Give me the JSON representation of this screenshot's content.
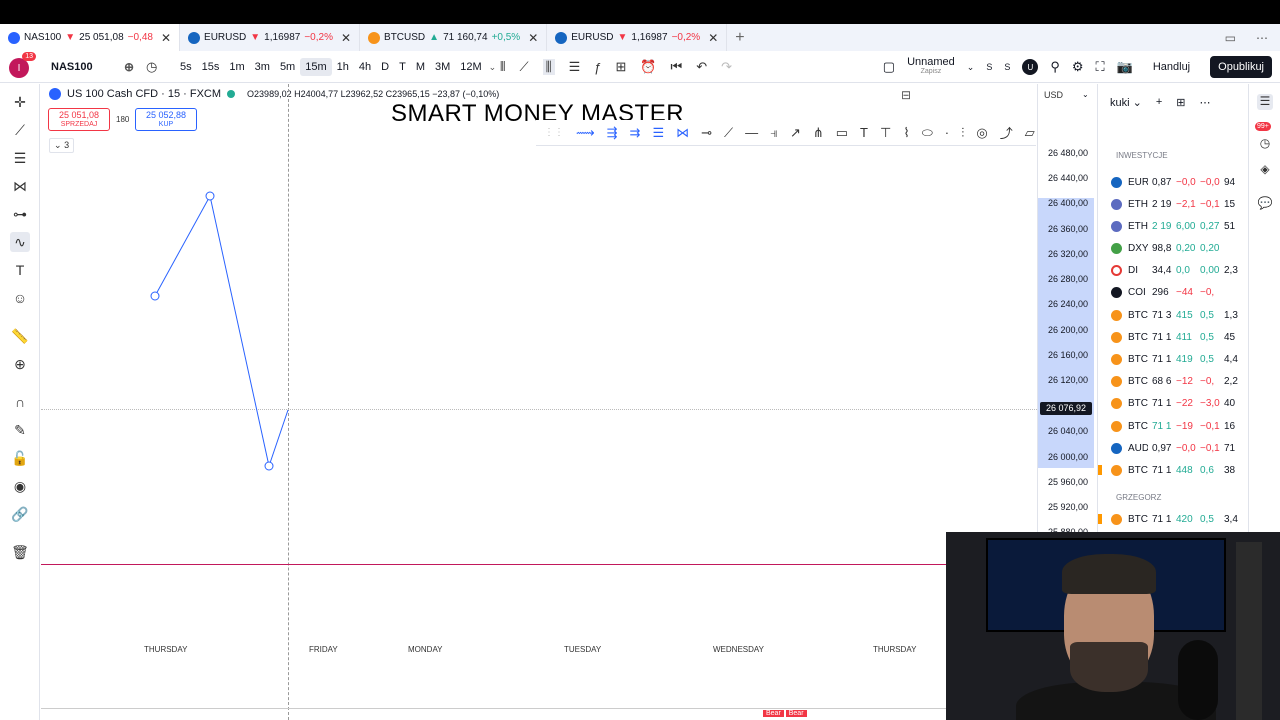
{
  "tabs": [
    {
      "symbol": "NAS100",
      "arrow": "▼",
      "price": "25 051,08",
      "change": "−0,48",
      "dir": "down",
      "active": true,
      "logo_color": "#2962ff"
    },
    {
      "symbol": "EURUSD",
      "arrow": "▼",
      "price": "1,16987",
      "change": "−0,2%",
      "dir": "down",
      "active": false,
      "logo_color": "#1565c0"
    },
    {
      "symbol": "BTCUSD",
      "arrow": "▲",
      "price": "71 160,74",
      "change": "+0,5%",
      "dir": "up",
      "active": false,
      "logo_color": "#f7931a"
    },
    {
      "symbol": "EURUSD",
      "arrow": "▼",
      "price": "1,16987",
      "change": "−0,2%",
      "dir": "down",
      "active": false,
      "logo_color": "#1565c0"
    }
  ],
  "toolbar": {
    "avatar_letter": "I",
    "avatar_badge": "13",
    "symbol": "NAS100",
    "timeframes": [
      "5s",
      "15s",
      "1m",
      "3m",
      "5m",
      "15m",
      "1h",
      "4h",
      "D",
      "T",
      "M",
      "3M",
      "12M"
    ],
    "selected_timeframe": "15m",
    "layout_name": "Unnamed",
    "layout_sub": "Zapisz",
    "s1": "S",
    "s2": "S",
    "u_badge": "U",
    "trade_label": "Handluj",
    "publish_label": "Opublikuj"
  },
  "chart": {
    "title": "US 100 Cash CFD · 15 · FXCM",
    "ohlc": "O23989,02 H24004,77 L23962,52 C23965,15 −23,87 (−0,10%)",
    "sell_price": "25 051,08",
    "sell_label": "SPRZEDAJ",
    "spread": "180",
    "buy_price": "25 052,88",
    "buy_label": "KUP",
    "indicators_count": "3",
    "watermark": "SMART MONEY MASTER",
    "days": [
      "THURSDAY",
      "FRIDAY",
      "MONDAY",
      "TUESDAY",
      "WEDNESDAY",
      "THURSDAY"
    ],
    "bear_labels": [
      "Bear",
      "Bear"
    ]
  },
  "price_scale": {
    "currency": "USD",
    "labels": [
      "26 480,00",
      "26 440,00",
      "26 400,00",
      "26 360,00",
      "26 320,00",
      "26 280,00",
      "26 240,00",
      "26 200,00",
      "26 160,00",
      "26 120,00",
      "26 040,00",
      "26 000,00",
      "25 960,00",
      "25 920,00",
      "25 880,00"
    ],
    "current": "26 076,92"
  },
  "watchlist": {
    "name": "kuki",
    "sections": [
      "INWESTYCJE",
      "GRZEGORZ"
    ],
    "rows": [
      {
        "sym": "EUR",
        "last": "0,87",
        "ch": "−0,0",
        "chp": "−0,0",
        "vol": "94",
        "color": "#1565c0",
        "dir": "neg"
      },
      {
        "sym": "ETH",
        "last": "2 19",
        "ch": "−2,1",
        "chp": "−0,1",
        "vol": "15",
        "color": "#5c6bc0",
        "dir": "neg"
      },
      {
        "sym": "ETH",
        "last": "2 19",
        "ch": "6,00",
        "chp": "0,27",
        "vol": "51",
        "color": "#5c6bc0",
        "dir": "pos"
      },
      {
        "sym": "DXY",
        "last": "98,8",
        "ch": "0,20",
        "chp": "0,20",
        "vol": "",
        "color": "#43a047",
        "dir": "pos"
      },
      {
        "sym": "DI",
        "last": "34,4",
        "ch": "0,0",
        "chp": "0,00",
        "vol": "2,3",
        "color": "#e53935",
        "dir": "pos"
      },
      {
        "sym": "COI",
        "last": "296",
        "ch": "−44",
        "chp": "−0,",
        "vol": "",
        "color": "#131722",
        "dir": "neg"
      },
      {
        "sym": "BTC",
        "last": "71 3",
        "ch": "415",
        "chp": "0,5",
        "vol": "1,3",
        "color": "#f7931a",
        "dir": "pos"
      },
      {
        "sym": "BTC",
        "last": "71 1",
        "ch": "411",
        "chp": "0,5",
        "vol": "45",
        "color": "#f7931a",
        "dir": "pos"
      },
      {
        "sym": "BTC",
        "last": "71 1",
        "ch": "419",
        "chp": "0,5",
        "vol": "4,4",
        "color": "#f7931a",
        "dir": "pos"
      },
      {
        "sym": "BTC",
        "last": "68 6",
        "ch": "−12",
        "chp": "−0,",
        "vol": "2,2",
        "color": "#f7931a",
        "dir": "neg"
      },
      {
        "sym": "BTC",
        "last": "71 1",
        "ch": "−22",
        "chp": "−3,0",
        "vol": "40",
        "color": "#f7931a",
        "dir": "neg"
      },
      {
        "sym": "BTC",
        "last": "71 1",
        "ch": "−19",
        "chp": "−0,1",
        "vol": "16",
        "color": "#f7931a",
        "dir": "neg"
      },
      {
        "sym": "AUD",
        "last": "0,97",
        "ch": "−0,0",
        "chp": "−0,1",
        "vol": "71",
        "color": "#1565c0",
        "dir": "neg"
      },
      {
        "sym": "BTC",
        "last": "71 1",
        "ch": "448",
        "chp": "0,6",
        "vol": "38",
        "color": "#f7931a",
        "dir": "pos"
      },
      {
        "sym": "BTC",
        "last": "71 1",
        "ch": "420",
        "chp": "0,5",
        "vol": "3,4",
        "color": "#f7931a",
        "dir": "pos"
      }
    ]
  },
  "right_bar": {
    "badge": "99+"
  },
  "icons": {
    "crosshair": "crosshair-icon",
    "trendline": "trendline-icon",
    "fib": "fib-icon",
    "pattern": "pattern-icon",
    "forecast": "forecast-icon",
    "brush": "brush-icon",
    "text": "text-icon",
    "emoji": "emoji-icon",
    "ruler": "ruler-icon",
    "zoom": "zoom-icon",
    "magnet": "magnet-icon",
    "lock-draw": "lock-draw-icon",
    "lock": "lock-icon",
    "eye": "eye-icon",
    "link": "link-icon",
    "trash": "trash-icon"
  },
  "colors": {
    "accent": "#2962ff",
    "down": "#f23645",
    "up": "#22ab94",
    "redline": "#c2185b",
    "highlight": "#c8d7fb"
  }
}
